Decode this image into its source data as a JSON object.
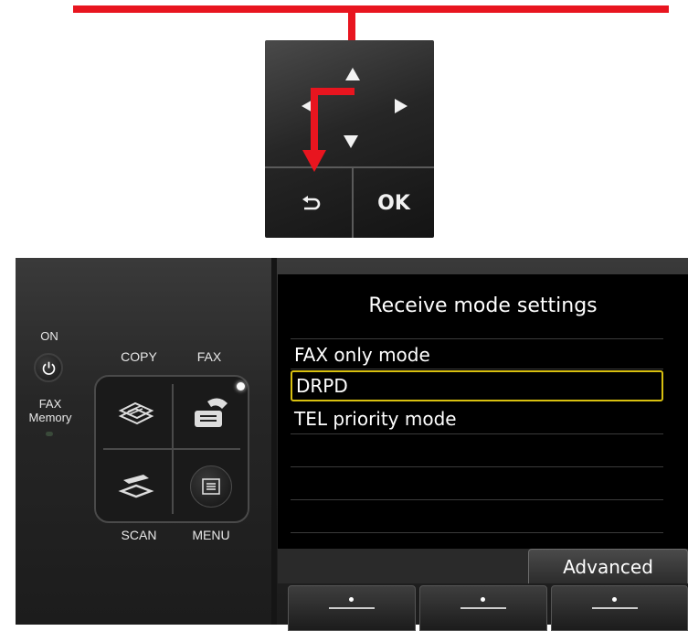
{
  "dpad": {
    "ok_label": "OK"
  },
  "panel": {
    "on_label": "ON",
    "fax_memory_label_line1": "FAX",
    "fax_memory_label_line2": "Memory",
    "buttons": {
      "copy": "COPY",
      "fax": "FAX",
      "scan": "SCAN",
      "menu": "MENU"
    }
  },
  "screen": {
    "title": "Receive mode settings",
    "items": [
      {
        "label": "FAX only mode",
        "selected": false
      },
      {
        "label": "DRPD",
        "selected": true
      },
      {
        "label": "TEL priority mode",
        "selected": false
      },
      {
        "label": "",
        "selected": false
      },
      {
        "label": "",
        "selected": false
      },
      {
        "label": "",
        "selected": false
      }
    ],
    "advanced_label": "Advanced"
  },
  "colors": {
    "callout_red": "#e8151f",
    "selection_outline": "#d8c010",
    "lcd_background": "#000000"
  },
  "icons": {
    "back": "back-arrow-icon",
    "power": "power-icon",
    "copy": "copy-icon",
    "fax": "fax-icon",
    "scan": "scan-icon",
    "menu": "menu-list-icon"
  }
}
